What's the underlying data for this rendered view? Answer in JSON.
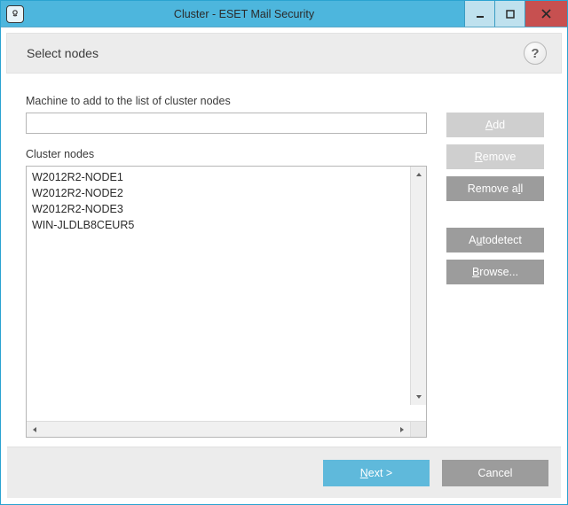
{
  "window": {
    "title": "Cluster - ESET Mail Security"
  },
  "header": {
    "heading": "Select nodes"
  },
  "fields": {
    "machine_label": "Machine to add to the list of cluster nodes",
    "machine_value": "",
    "nodes_label": "Cluster nodes"
  },
  "nodes": [
    "W2012R2-NODE1",
    "W2012R2-NODE2",
    "W2012R2-NODE3",
    "WIN-JLDLB8CEUR5"
  ],
  "buttons": {
    "add": "Add",
    "remove": "Remove",
    "remove_all": "Remove all",
    "autodetect": "Autodetect",
    "browse": "Browse...",
    "next": "Next >",
    "cancel": "Cancel",
    "help": "?"
  }
}
